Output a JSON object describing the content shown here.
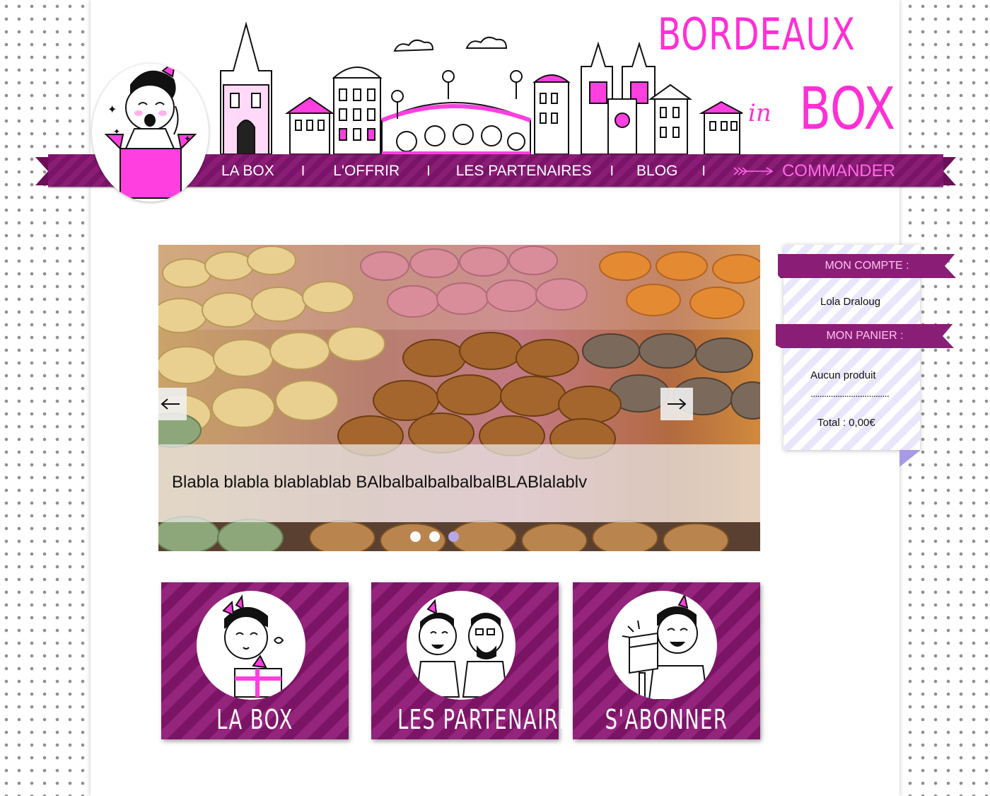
{
  "brand": {
    "line1": "BORDEAUX",
    "in": "in",
    "line2": "BOX",
    "color": "#ff2fd6"
  },
  "nav": {
    "items": [
      {
        "label": "LA BOX"
      },
      {
        "label": "L'OFFRIR"
      },
      {
        "label": "LES PARTENAIRES"
      },
      {
        "label": "BLOG"
      }
    ],
    "separator": "I",
    "cta": {
      "label": "COMMANDER",
      "icon": "arrow-right-icon"
    },
    "ribbon_color": "#8a1d76"
  },
  "slider": {
    "caption": "Blabla blabla blablablab BAlbalbalbalbalbalBLABlalablv",
    "prev_icon": "arrow-left-icon",
    "next_icon": "arrow-right-icon",
    "dots": 3,
    "active_dot": 3
  },
  "tiles": [
    {
      "label": "LA BOX",
      "icon": "girl-with-gift-icon"
    },
    {
      "label": "LES PARTENAIRES",
      "icon": "partners-icon"
    },
    {
      "label": "S'ABONNER",
      "icon": "mailbox-icon"
    }
  ],
  "sidebar": {
    "account_title": "MON COMPTE :",
    "user_name": "Lola Draloug",
    "cart_title": "MON PANIER :",
    "cart_empty": "Aucun produit",
    "cart_separator": "...................................",
    "cart_total": "Total : 0,00€"
  },
  "colors": {
    "ribbon": "#8a1d76",
    "accent_pink": "#ff2fd6",
    "lavender": "#b8a7e6"
  }
}
